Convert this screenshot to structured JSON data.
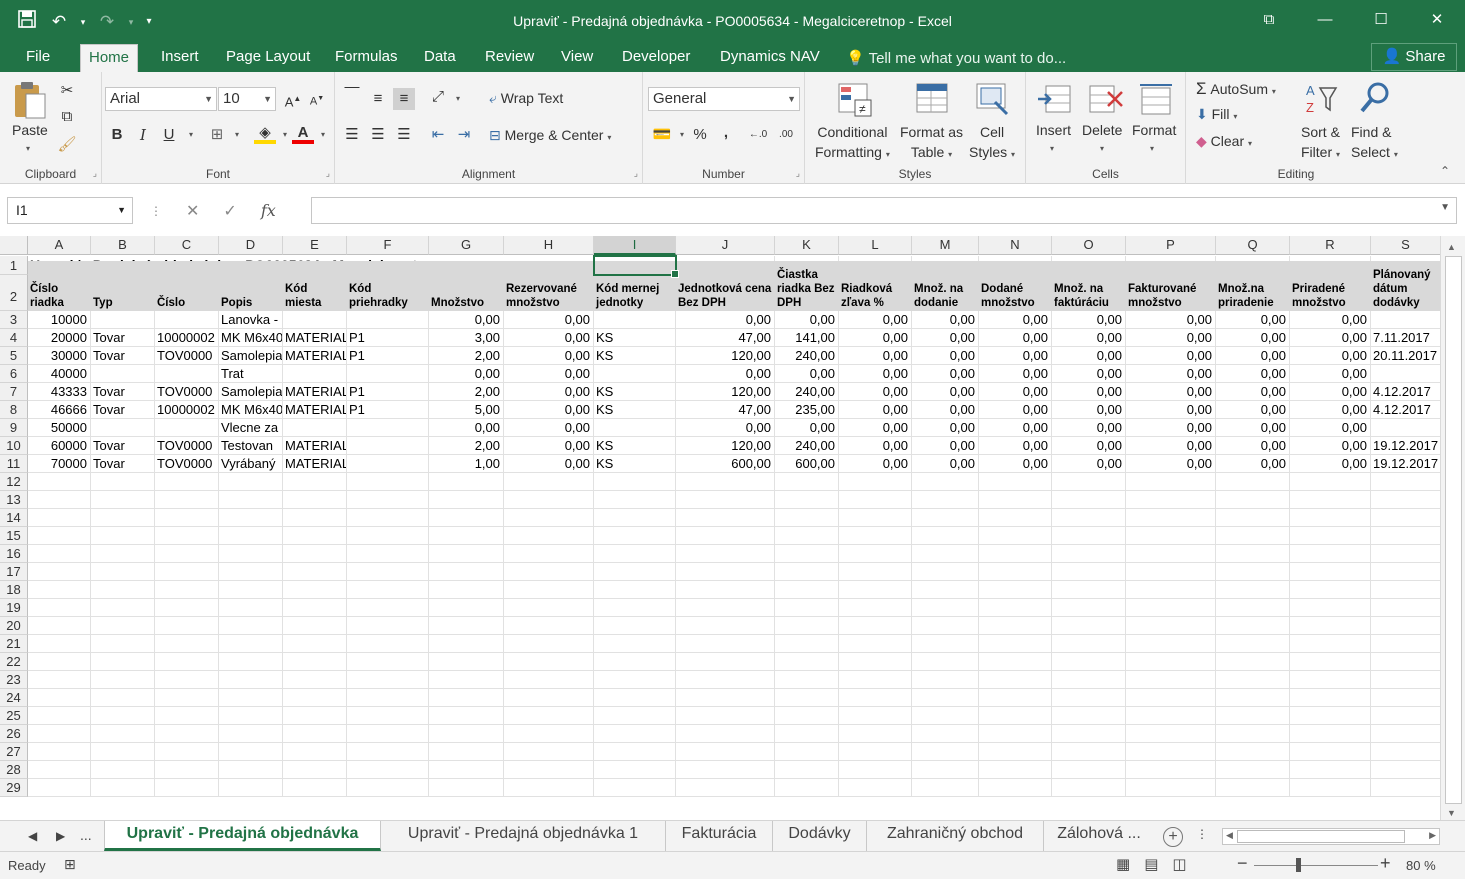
{
  "window": {
    "title": "Upraviť - Predajná objednávka - PO0005634 - Megalciceretnop - Excel",
    "controls": [
      "⧉",
      "—",
      "☐",
      "✕"
    ]
  },
  "qat": {
    "save": "💾",
    "undo": "↶",
    "redo": "↷",
    "customize": "▾"
  },
  "tabs": [
    "File",
    "Home",
    "Insert",
    "Page Layout",
    "Formulas",
    "Data",
    "Review",
    "View",
    "Developer",
    "Dynamics NAV"
  ],
  "active_tab": "Home",
  "tell_me": "Tell me what you want to do...",
  "share": "Share",
  "ribbon": {
    "clipboard": {
      "label": "Clipboard",
      "paste": "Paste"
    },
    "font": {
      "label": "Font",
      "name": "Arial",
      "size": "10",
      "bold": "B",
      "italic": "I",
      "underline": "U"
    },
    "alignment": {
      "label": "Alignment",
      "wrap_text": "Wrap Text",
      "merge_center": "Merge & Center"
    },
    "number": {
      "label": "Number",
      "format": "General",
      "percent": "%",
      "comma": ","
    },
    "styles": {
      "label": "Styles",
      "conditional": [
        "Conditional",
        "Formatting"
      ],
      "format_table": [
        "Format as",
        "Table"
      ],
      "cell_styles": [
        "Cell",
        "Styles"
      ]
    },
    "cells": {
      "label": "Cells",
      "insert": "Insert",
      "delete": "Delete",
      "format": "Format"
    },
    "editing": {
      "label": "Editing",
      "autosum": "AutoSum",
      "fill": "Fill",
      "clear": "Clear",
      "sort": [
        "Sort &",
        "Filter"
      ],
      "find": [
        "Find &",
        "Select"
      ]
    }
  },
  "name_box": "I1",
  "formula": "",
  "columns": [
    "A",
    "B",
    "C",
    "D",
    "E",
    "F",
    "G",
    "H",
    "I",
    "J",
    "K",
    "L",
    "M",
    "N",
    "O",
    "P",
    "Q",
    "R",
    "S"
  ],
  "selected_column": "I",
  "sheet": {
    "title": "Upraviť - Predajná objednávka - PO0005634 - Megalciceretnop",
    "headers": [
      "Číslo riadka",
      "Typ",
      "Číslo",
      "Popis",
      "Kód miesta",
      "Kód priehradky",
      "Množstvo",
      "Rezervované množstvo",
      "Kód mernej jednotky",
      "Jednotková cena Bez DPH",
      "Čiastka riadka Bez DPH",
      "Riadková zľava %",
      "Množ. na dodanie",
      "Dodané množstvo",
      "Množ. na faktúráciu",
      "Fakturované množstvo",
      "Množ.na priradenie",
      "Priradené množstvo",
      "Plánovaný dátum dodávky"
    ],
    "rows": [
      [
        "10000",
        "",
        "",
        "Lanovka -",
        "",
        "",
        "0,00",
        "0,00",
        "",
        "0,00",
        "0,00",
        "0,00",
        "0,00",
        "0,00",
        "0,00",
        "0,00",
        "0,00",
        "0,00",
        ""
      ],
      [
        "20000",
        "Tovar",
        "10000002",
        "MK M6x40",
        "MATERIAL",
        "P1",
        "3,00",
        "0,00",
        "KS",
        "47,00",
        "141,00",
        "0,00",
        "0,00",
        "0,00",
        "0,00",
        "0,00",
        "0,00",
        "0,00",
        "7.11.2017"
      ],
      [
        "30000",
        "Tovar",
        "TOV0000",
        "Samolepia",
        "MATERIAL",
        "P1",
        "2,00",
        "0,00",
        "KS",
        "120,00",
        "240,00",
        "0,00",
        "0,00",
        "0,00",
        "0,00",
        "0,00",
        "0,00",
        "0,00",
        "20.11.2017"
      ],
      [
        "40000",
        "",
        "",
        "Trat",
        "",
        "",
        "0,00",
        "0,00",
        "",
        "0,00",
        "0,00",
        "0,00",
        "0,00",
        "0,00",
        "0,00",
        "0,00",
        "0,00",
        "0,00",
        ""
      ],
      [
        "43333",
        "Tovar",
        "TOV0000",
        "Samolepia",
        "MATERIAL",
        "P1",
        "2,00",
        "0,00",
        "KS",
        "120,00",
        "240,00",
        "0,00",
        "0,00",
        "0,00",
        "0,00",
        "0,00",
        "0,00",
        "0,00",
        "4.12.2017"
      ],
      [
        "46666",
        "Tovar",
        "10000002",
        "MK M6x40",
        "MATERIAL",
        "P1",
        "5,00",
        "0,00",
        "KS",
        "47,00",
        "235,00",
        "0,00",
        "0,00",
        "0,00",
        "0,00",
        "0,00",
        "0,00",
        "0,00",
        "4.12.2017"
      ],
      [
        "50000",
        "",
        "",
        "Vlecne za",
        "",
        "",
        "0,00",
        "0,00",
        "",
        "0,00",
        "0,00",
        "0,00",
        "0,00",
        "0,00",
        "0,00",
        "0,00",
        "0,00",
        "0,00",
        ""
      ],
      [
        "60000",
        "Tovar",
        "TOV0000",
        "Testovan",
        "MATERIAL",
        "",
        "2,00",
        "0,00",
        "KS",
        "120,00",
        "240,00",
        "0,00",
        "0,00",
        "0,00",
        "0,00",
        "0,00",
        "0,00",
        "0,00",
        "19.12.2017"
      ],
      [
        "70000",
        "Tovar",
        "TOV0000",
        "Vyrábaný",
        "MATERIAL",
        "",
        "1,00",
        "0,00",
        "KS",
        "600,00",
        "600,00",
        "0,00",
        "0,00",
        "0,00",
        "0,00",
        "0,00",
        "0,00",
        "0,00",
        "19.12.2017"
      ]
    ]
  },
  "row_numbers": [
    "1",
    "2",
    "3",
    "4",
    "5",
    "6",
    "7",
    "8",
    "9",
    "10",
    "11",
    "12",
    "13",
    "14",
    "15",
    "16",
    "17",
    "18",
    "19",
    "20",
    "21",
    "22",
    "23",
    "24",
    "25",
    "26",
    "27",
    "28",
    "29"
  ],
  "sheet_tabs": [
    "Upraviť - Predajná objednávka",
    "Upraviť - Predajná objednávka 1",
    "Fakturácia",
    "Dodávky",
    "Zahraničný obchod",
    "Zálohová ..."
  ],
  "active_sheet": "Upraviť - Predajná objednávka",
  "sheet_nav_more": "...",
  "status": {
    "ready": "Ready",
    "zoom": "80 %"
  },
  "colors": {
    "accent": "#217346",
    "header_fill": "#d9d9d9"
  }
}
